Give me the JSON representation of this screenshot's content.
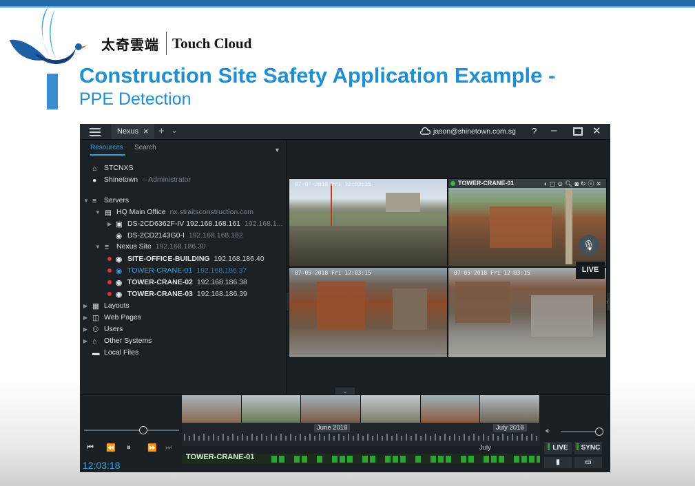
{
  "slide": {
    "brand_cn": "太奇雲端",
    "brand_en": "Touch Cloud",
    "title": "Construction Site Safety Application Example -",
    "subtitle": "PPE Detection"
  },
  "app": {
    "tab_label": "Nexus",
    "account": "jason@shinetown.com.sg",
    "help": "?",
    "sidebar_tabs": [
      "Resources",
      "Search"
    ],
    "tree": {
      "system": "STCNXS",
      "user": "Shinetown",
      "user_role": "– Administrator",
      "servers_label": "Servers",
      "server1": {
        "name": "HQ Main Office",
        "host": "nx.straitsconstruction.com"
      },
      "server1_cams": [
        {
          "name": "DS-2CD6362F-IV 192.168.168.161",
          "ip": "192.168.1..."
        },
        {
          "name": "DS-2CD2143G0-I",
          "ip": "192.168.168.162"
        }
      ],
      "server2": {
        "name": "Nexus Site",
        "host": "192.168.186.30"
      },
      "server2_cams": [
        {
          "name": "SITE-OFFICE-BUILDING",
          "ip": "192.168.186.40"
        },
        {
          "name": "TOWER-CRANE-01",
          "ip": "192.168.186.37"
        },
        {
          "name": "TOWER-CRANE-02",
          "ip": "192.168.186.38"
        },
        {
          "name": "TOWER-CRANE-03",
          "ip": "192.168.186.39"
        }
      ],
      "groups": [
        "Layouts",
        "Web Pages",
        "Users",
        "Other Systems",
        "Local Files"
      ]
    },
    "viewer": {
      "tile1_timestamp": "07-0?-2018 Fri 12:03:15",
      "tile2_camera": "TOWER-CRANE-01",
      "tile3_timestamp": "07-05-2018 Fri 12:03:15",
      "tile4_timestamp": "07-05-2018 Fri 12:03:15",
      "live_badge": "LIVE"
    },
    "timeline": {
      "month1": "June 2018",
      "month2": "July 2018",
      "mid_label": "July",
      "track_name": "TOWER-CRANE-01",
      "current_time": "12:03:18",
      "live_button": "LIVE",
      "sync_button": "SYNC"
    },
    "colors": {
      "accent": "#3aa3e6",
      "recording": "#2aa52f",
      "alert_dot": "#e0303a",
      "title_blue": "#1f8fd2"
    }
  }
}
